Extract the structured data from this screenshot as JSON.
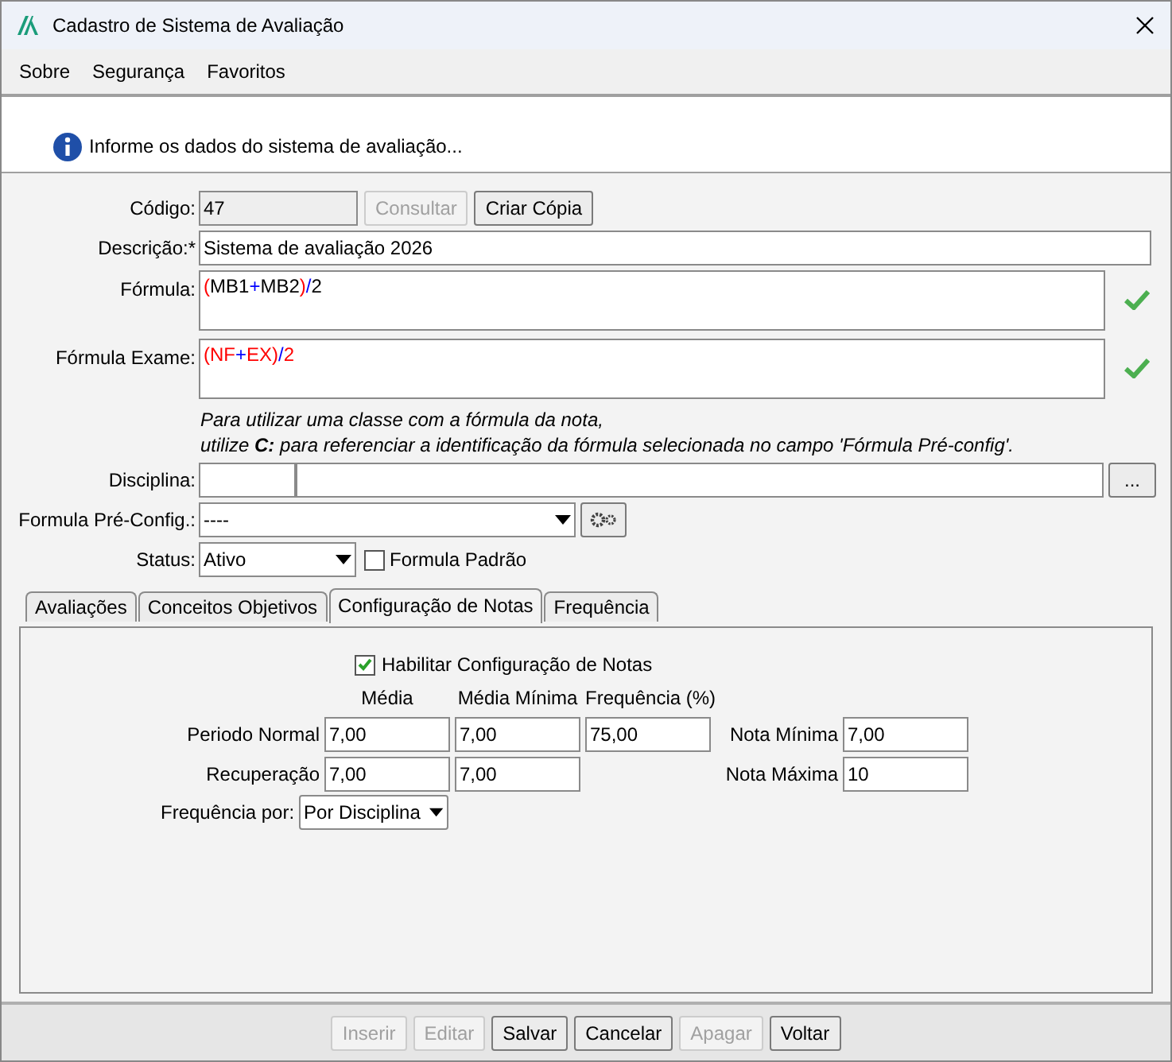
{
  "window": {
    "title": "Cadastro de Sistema de Avaliação"
  },
  "menu": [
    {
      "label": "Sobre"
    },
    {
      "label": "Segurança"
    },
    {
      "label": "Favoritos"
    }
  ],
  "info_message": "Informe os dados do sistema de avaliação...",
  "codigo": {
    "label": "Código:",
    "value": "47",
    "buttons": [
      {
        "label": "Consultar",
        "disabled": true
      },
      {
        "label": "Criar Cópia",
        "disabled": false
      }
    ]
  },
  "descricao": {
    "label": "Descrição:*",
    "value": "Sistema de avaliação 2026"
  },
  "formulas": [
    {
      "label": "Fórmula:",
      "valid": true,
      "tokens": [
        {
          "text": "(",
          "color": "#ff0000"
        },
        {
          "text": "MB1",
          "color": "#000000"
        },
        {
          "text": "+",
          "color": "#0000ff"
        },
        {
          "text": "MB2",
          "color": "#000000"
        },
        {
          "text": ")",
          "color": "#ff0000"
        },
        {
          "text": "/",
          "color": "#0000ff"
        },
        {
          "text": "2",
          "color": "#000000"
        }
      ]
    },
    {
      "label": "Fórmula Exame:",
      "valid": true,
      "tokens": [
        {
          "text": "(",
          "color": "#ff0000"
        },
        {
          "text": "NF",
          "color": "#ff0000"
        },
        {
          "text": "+",
          "color": "#0000ff"
        },
        {
          "text": "EX",
          "color": "#ff0000"
        },
        {
          "text": ")",
          "color": "#ff0000"
        },
        {
          "text": "/",
          "color": "#0000ff"
        },
        {
          "text": "2",
          "color": "#ff0000"
        }
      ]
    }
  ],
  "hint": [
    "Para utilizar uma classe com a fórmula da nota,",
    "utilize **C:** para referenciar a identificação da fórmula selecionada no campo 'Fórmula Pré-config'."
  ],
  "disciplina": {
    "label": "Disciplina:",
    "button": "..."
  },
  "formula_pre_config": {
    "label": "Formula Pré-Config.:",
    "value": "----"
  },
  "status": {
    "label": "Status:",
    "value": "Ativo",
    "checkbox": {
      "label": "Formula Padrão",
      "checked": false
    }
  },
  "tabs": [
    {
      "label": "Avaliações",
      "selected": false
    },
    {
      "label": "Conceitos Objetivos",
      "selected": false
    },
    {
      "label": "Configuração de Notas",
      "selected": true
    },
    {
      "label": "Frequência",
      "selected": false
    }
  ],
  "notas": {
    "enable": {
      "label": "Habilitar Configuração de Notas",
      "checked": true
    },
    "columns": [
      "Média",
      "Média Mínima",
      "Frequência (%)"
    ],
    "rows": [
      {
        "label": "Periodo Normal",
        "values": [
          "7,00",
          "7,00",
          "75,00"
        ],
        "side_label": "Nota Mínima",
        "side_value": "7,00"
      },
      {
        "label": "Recuperação",
        "values": [
          "7,00",
          "7,00"
        ],
        "side_label": "Nota Máxima",
        "side_value": "10"
      }
    ],
    "frequencia_por": {
      "label": "Frequência por:",
      "value": "Por Disciplina"
    }
  },
  "buttons": [
    {
      "label": "Inserir",
      "disabled": true
    },
    {
      "label": "Editar",
      "disabled": true
    },
    {
      "label": "Salvar",
      "disabled": false
    },
    {
      "label": "Cancelar",
      "disabled": false
    },
    {
      "label": "Apagar",
      "disabled": true
    },
    {
      "label": "Voltar",
      "disabled": false
    }
  ]
}
